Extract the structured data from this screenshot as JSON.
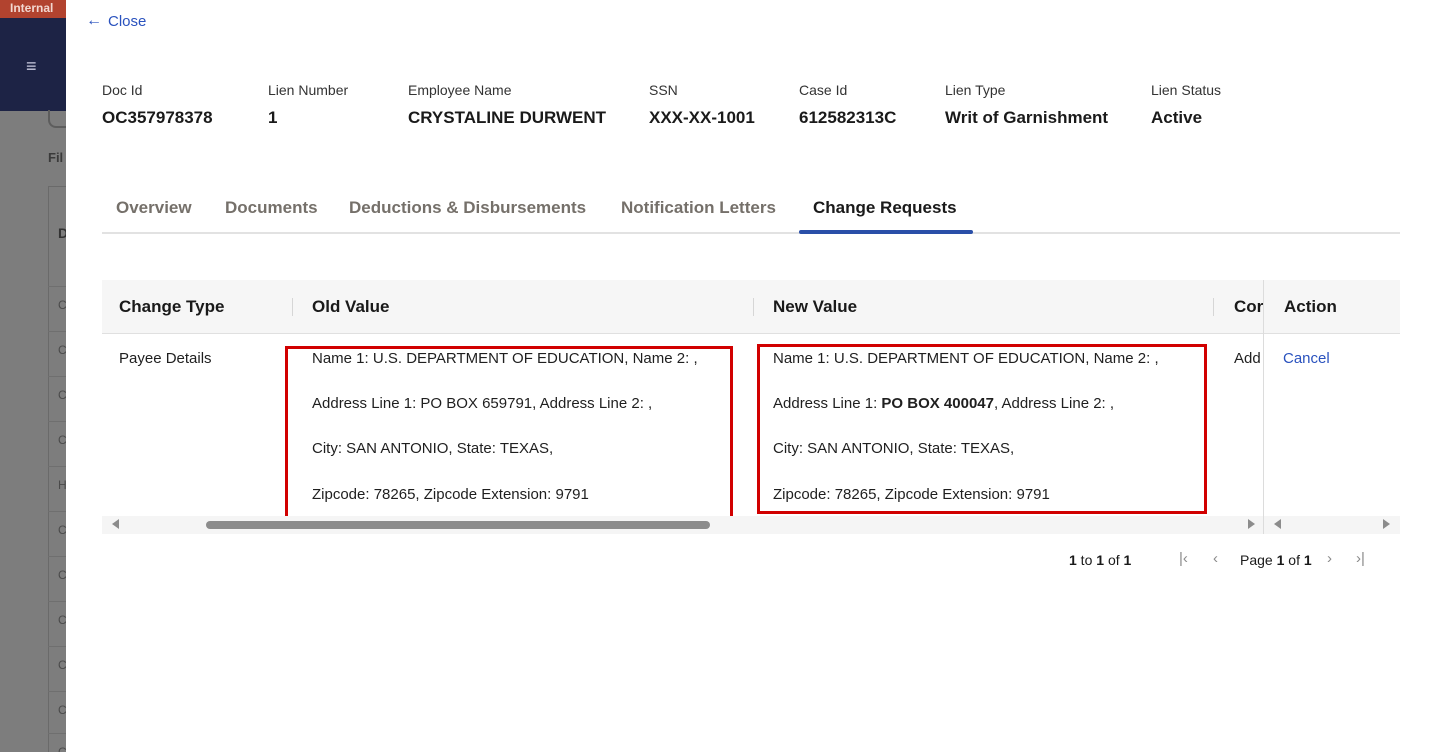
{
  "background": {
    "banner_text": "Internal",
    "filter_label": "Fil",
    "table_header_letter": "D",
    "row_letters": [
      "C",
      "C",
      "C",
      "C",
      "H",
      "C",
      "C",
      "C",
      "C",
      "C",
      "C"
    ]
  },
  "drawer": {
    "close_label": "Close",
    "summary": [
      {
        "label": "Doc Id",
        "value": "OC357978378"
      },
      {
        "label": "Lien Number",
        "value": "1"
      },
      {
        "label": "Employee Name",
        "value": "CRYSTALINE DURWENT"
      },
      {
        "label": "SSN",
        "value": "XXX-XX-1001"
      },
      {
        "label": "Case Id",
        "value": "612582313C"
      },
      {
        "label": "Lien Type",
        "value": "Writ of Garnishment"
      },
      {
        "label": "Lien Status",
        "value": "Active"
      }
    ],
    "tabs": [
      {
        "label": "Overview",
        "active": false
      },
      {
        "label": "Documents",
        "active": false
      },
      {
        "label": "Deductions & Disbursements",
        "active": false
      },
      {
        "label": "Notification Letters",
        "active": false
      },
      {
        "label": "Change Requests",
        "active": true
      }
    ],
    "table": {
      "columns": [
        "Change Type",
        "Old Value",
        "New Value",
        "Cor",
        "Action"
      ],
      "rows": [
        {
          "change_type": "Payee Details",
          "old_value": [
            "Name 1: U.S. DEPARTMENT OF EDUCATION, Name 2: ,",
            "Address Line 1: PO BOX 659791, Address Line 2: ,",
            "City: SAN ANTONIO, State: TEXAS,",
            "Zipcode: 78265, Zipcode Extension: 9791"
          ],
          "new_value": {
            "line1": "Name 1: U.S. DEPARTMENT OF EDUCATION, Name 2: ,",
            "line2_prefix": "Address Line 1: ",
            "line2_bold": "PO BOX 400047",
            "line2_suffix": ", Address Line 2: ,",
            "line3": "City: SAN ANTONIO, State: TEXAS,",
            "line4": "Zipcode: 78265, Zipcode Extension: 9791"
          },
          "comment_truncated": "Add",
          "action": "Cancel"
        }
      ]
    },
    "pagination": {
      "range_prefix": "1",
      "range_to": " to ",
      "range_end": "1",
      "range_of": " of ",
      "range_total": "1",
      "page_prefix": "Page ",
      "page_current": "1",
      "page_of": " of ",
      "page_total": "1"
    },
    "colors": {
      "accent": "#2a4fa8",
      "link": "#2a52be",
      "highlight": "#d10000"
    }
  }
}
